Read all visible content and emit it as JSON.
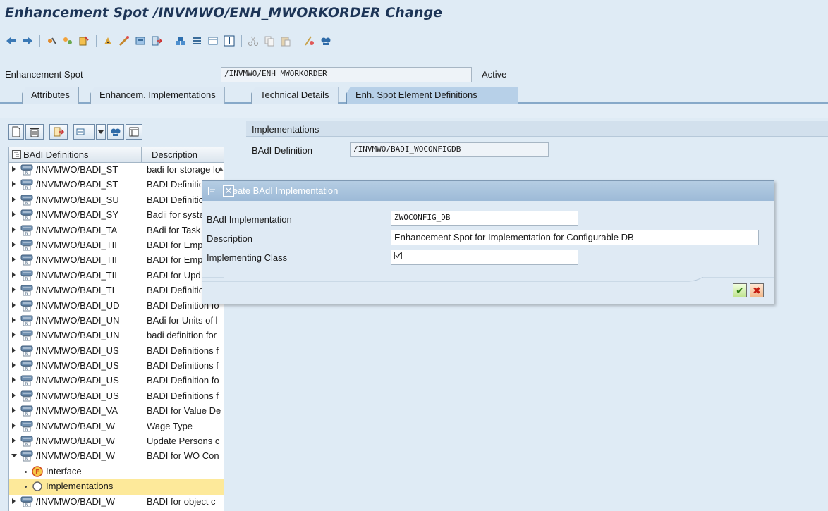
{
  "title": "Enhancement Spot /INVMWO/ENH_MWORKORDER Change",
  "toolbar": {
    "icons": [
      "back-icon",
      "forward-icon",
      "other-object-icon",
      "display-change-icon",
      "activate-icon",
      "check-icon",
      "test-icon",
      "where-used-icon",
      "navigate-icon",
      "object-list-icon",
      "enhancement-info-icon",
      "display-object-list-icon",
      "info-icon",
      "cut-icon",
      "copy-icon",
      "paste-icon",
      "pattern-icon",
      "find-icon"
    ]
  },
  "header": {
    "label": "Enhancement Spot",
    "value": "/INVMWO/ENH_MWORKORDER",
    "status": "Active"
  },
  "tabs": [
    {
      "label": "Attributes"
    },
    {
      "label": "Enhancem. Implementations"
    },
    {
      "label": "Technical Details"
    },
    {
      "label": "Enh. Spot Element Definitions"
    }
  ],
  "tree": {
    "col_name": "BAdI Definitions",
    "col_desc": "Description",
    "rows": [
      {
        "name": "/INVMWO/BADI_ST",
        "desc": "badi for storage lo"
      },
      {
        "name": "/INVMWO/BADI_ST",
        "desc": "BADI Definition"
      },
      {
        "name": "/INVMWO/BADI_SU",
        "desc": "BADI Definitio"
      },
      {
        "name": "/INVMWO/BADI_SY",
        "desc": "Badii for syste"
      },
      {
        "name": "/INVMWO/BADI_TA",
        "desc": "BAdi for Task"
      },
      {
        "name": "/INVMWO/BADI_TII",
        "desc": "BADI for Emp"
      },
      {
        "name": "/INVMWO/BADI_TII",
        "desc": "BADI for Emp"
      },
      {
        "name": "/INVMWO/BADI_TII",
        "desc": "BADI for Upd"
      },
      {
        "name": "/INVMWO/BADI_TI",
        "desc": "BADI Definitio"
      },
      {
        "name": "/INVMWO/BADI_UD",
        "desc": "BADI Definition fo"
      },
      {
        "name": "/INVMWO/BADI_UN",
        "desc": "BAdi for Units of l"
      },
      {
        "name": "/INVMWO/BADI_UN",
        "desc": "badi definition for"
      },
      {
        "name": "/INVMWO/BADI_US",
        "desc": "BADI Definitions f"
      },
      {
        "name": "/INVMWO/BADI_US",
        "desc": "BADI Definitions f"
      },
      {
        "name": "/INVMWO/BADI_US",
        "desc": "BADI Definition fo"
      },
      {
        "name": "/INVMWO/BADI_US",
        "desc": "BADI Definitions f"
      },
      {
        "name": "/INVMWO/BADI_VA",
        "desc": "BADI for Value De"
      },
      {
        "name": "/INVMWO/BADI_W",
        "desc": "Wage Type"
      },
      {
        "name": "/INVMWO/BADI_W",
        "desc": "Update Persons c"
      },
      {
        "name": "/INVMWO/BADI_W",
        "desc": "BADI for WO Con"
      }
    ],
    "children": [
      {
        "name": "Interface"
      },
      {
        "name": "Implementations"
      }
    ],
    "last_row": {
      "name": "/INVMWO/BADI_W",
      "desc": "BADI for object c"
    }
  },
  "right": {
    "section_title": "Implementations",
    "badi_label": "BAdI Definition",
    "badi_value": "/INVMWO/BADI_WOCONFIGDB"
  },
  "dialog": {
    "title": "Create BAdI Implementation",
    "impl_label": "BAdI Implementation",
    "impl_value": "ZWOCONFIG_DB",
    "desc_label": "Description",
    "desc_value": "Enhancement Spot for Implementation for Configurable DB",
    "class_label": "Implementing Class",
    "ok_glyph": "✔",
    "cancel_glyph": "✖",
    "close_glyph": "✕"
  }
}
